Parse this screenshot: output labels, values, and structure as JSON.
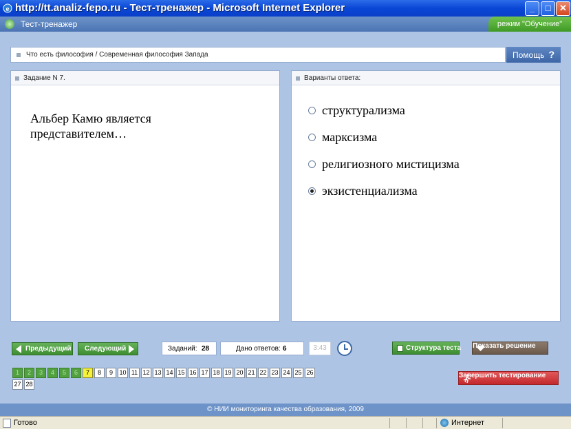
{
  "window": {
    "title": "http://tt.analiz-fepo.ru - Тест-тренажер - Microsoft Internet Explorer",
    "minimize_label": "_",
    "maximize_label": "□",
    "close_label": "✕"
  },
  "app": {
    "title": "Тест-тренажер",
    "mode": "режим \"Обучение\""
  },
  "breadcrumb": "Что есть философия / Современная философия Запада",
  "help": {
    "label": "Помощь",
    "icon": "?"
  },
  "task": {
    "header": "Задание N 7.",
    "question": "Альбер Камю является представителем…"
  },
  "answers": {
    "header": "Варианты ответа:",
    "options": [
      {
        "label": "структурализма",
        "checked": false
      },
      {
        "label": "марксизма",
        "checked": false
      },
      {
        "label": "религиозного мистицизма",
        "checked": false
      },
      {
        "label": "экзистенциализма",
        "checked": true
      }
    ]
  },
  "controls": {
    "prev_label": "Предыдущий",
    "next_label": "Следующий",
    "tasks_label": "Заданий:",
    "tasks_count": "28",
    "answered_label": "Дано ответов:",
    "answered_count": "6",
    "timer": "3:43",
    "structure_label": "Структура теста",
    "show_solution_label": "Показать решение",
    "finish_label": "Завершить тестирование"
  },
  "task_numbers": [
    {
      "n": "1",
      "state": "done"
    },
    {
      "n": "2",
      "state": "done"
    },
    {
      "n": "3",
      "state": "done"
    },
    {
      "n": "4",
      "state": "done"
    },
    {
      "n": "5",
      "state": "done"
    },
    {
      "n": "6",
      "state": "done"
    },
    {
      "n": "7",
      "state": "current"
    },
    {
      "n": "8",
      "state": "open"
    },
    {
      "n": "9",
      "state": "open"
    },
    {
      "n": "10",
      "state": "open"
    },
    {
      "n": "11",
      "state": "open"
    },
    {
      "n": "12",
      "state": "open"
    },
    {
      "n": "13",
      "state": "open"
    },
    {
      "n": "14",
      "state": "open"
    },
    {
      "n": "15",
      "state": "open"
    },
    {
      "n": "16",
      "state": "open"
    },
    {
      "n": "17",
      "state": "open"
    },
    {
      "n": "18",
      "state": "open"
    },
    {
      "n": "19",
      "state": "open"
    },
    {
      "n": "20",
      "state": "open"
    },
    {
      "n": "21",
      "state": "open"
    },
    {
      "n": "22",
      "state": "open"
    },
    {
      "n": "23",
      "state": "open"
    },
    {
      "n": "24",
      "state": "open"
    },
    {
      "n": "25",
      "state": "open"
    },
    {
      "n": "26",
      "state": "open"
    },
    {
      "n": "27",
      "state": "open"
    },
    {
      "n": "28",
      "state": "open"
    }
  ],
  "footer": "© НИИ мониторинга качества образования, 2009",
  "status": {
    "ready": "Готово",
    "zone": "Интернет"
  }
}
